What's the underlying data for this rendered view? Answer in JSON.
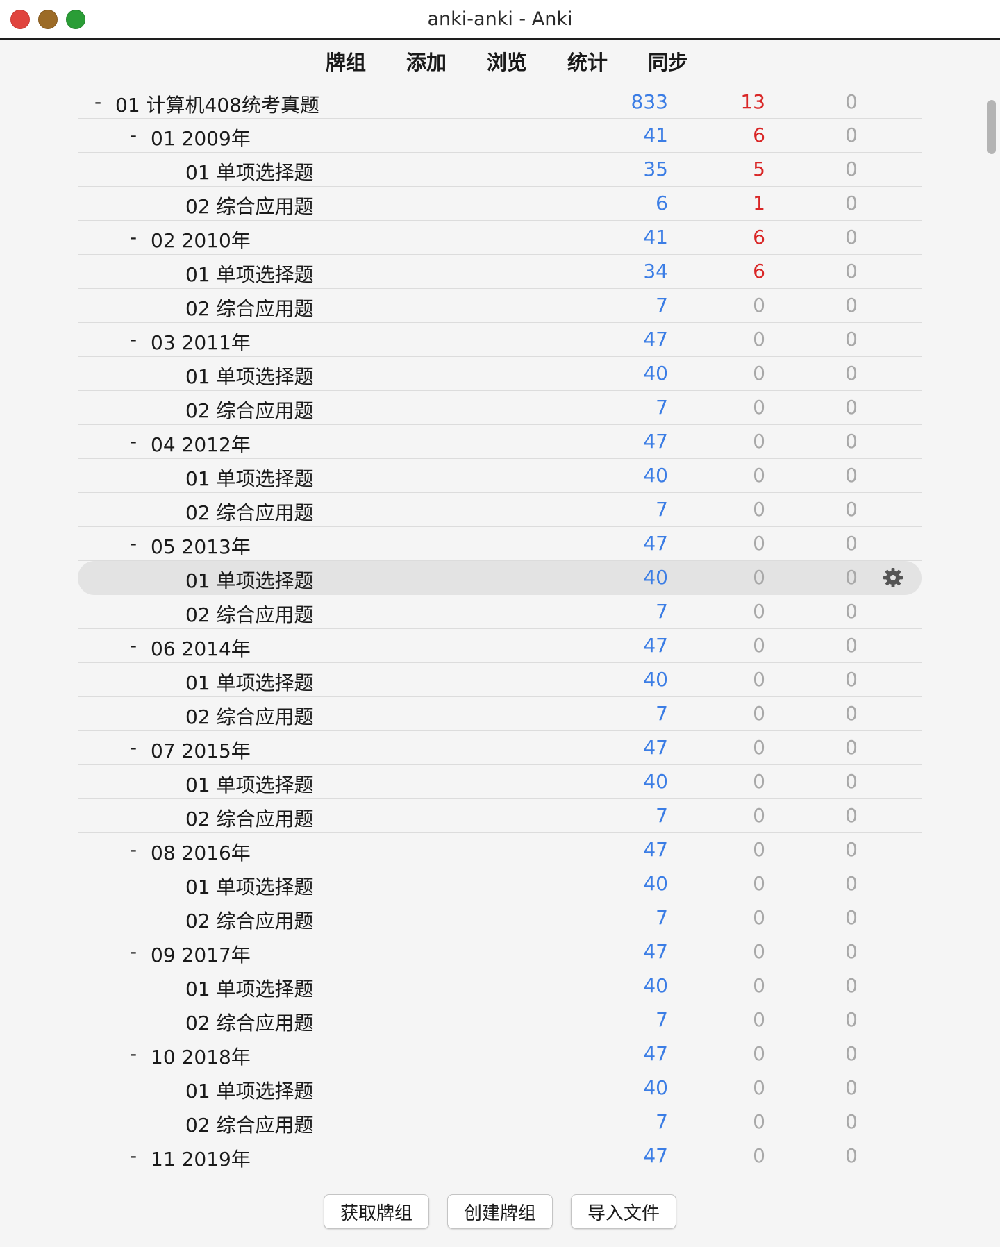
{
  "window": {
    "title": "anki-anki - Anki"
  },
  "toolbar": {
    "items": [
      "牌组",
      "添加",
      "浏览",
      "统计",
      "同步"
    ]
  },
  "colors": {
    "new_count": "#3b7de5",
    "learn_count": "#d92626",
    "zero_count": "#a8a8a8"
  },
  "decks": [
    {
      "level": 0,
      "expander": "-",
      "name": "01 计算机408统考真题",
      "new": "833",
      "learn": "13",
      "due": "0"
    },
    {
      "level": 1,
      "expander": "-",
      "name": "01 2009年",
      "new": "41",
      "learn": "6",
      "due": "0"
    },
    {
      "level": 2,
      "expander": "",
      "name": "01 单项选择题",
      "new": "35",
      "learn": "5",
      "due": "0"
    },
    {
      "level": 2,
      "expander": "",
      "name": "02 综合应用题",
      "new": "6",
      "learn": "1",
      "due": "0"
    },
    {
      "level": 1,
      "expander": "-",
      "name": "02 2010年",
      "new": "41",
      "learn": "6",
      "due": "0"
    },
    {
      "level": 2,
      "expander": "",
      "name": "01 单项选择题",
      "new": "34",
      "learn": "6",
      "due": "0"
    },
    {
      "level": 2,
      "expander": "",
      "name": "02 综合应用题",
      "new": "7",
      "learn": "0",
      "due": "0"
    },
    {
      "level": 1,
      "expander": "-",
      "name": "03 2011年",
      "new": "47",
      "learn": "0",
      "due": "0"
    },
    {
      "level": 2,
      "expander": "",
      "name": "01 单项选择题",
      "new": "40",
      "learn": "0",
      "due": "0"
    },
    {
      "level": 2,
      "expander": "",
      "name": "02 综合应用题",
      "new": "7",
      "learn": "0",
      "due": "0"
    },
    {
      "level": 1,
      "expander": "-",
      "name": "04 2012年",
      "new": "47",
      "learn": "0",
      "due": "0"
    },
    {
      "level": 2,
      "expander": "",
      "name": "01 单项选择题",
      "new": "40",
      "learn": "0",
      "due": "0"
    },
    {
      "level": 2,
      "expander": "",
      "name": "02 综合应用题",
      "new": "7",
      "learn": "0",
      "due": "0"
    },
    {
      "level": 1,
      "expander": "-",
      "name": "05 2013年",
      "new": "47",
      "learn": "0",
      "due": "0"
    },
    {
      "level": 2,
      "expander": "",
      "name": "01 单项选择题",
      "new": "40",
      "learn": "0",
      "due": "0",
      "selected": true
    },
    {
      "level": 2,
      "expander": "",
      "name": "02 综合应用题",
      "new": "7",
      "learn": "0",
      "due": "0"
    },
    {
      "level": 1,
      "expander": "-",
      "name": "06 2014年",
      "new": "47",
      "learn": "0",
      "due": "0"
    },
    {
      "level": 2,
      "expander": "",
      "name": "01 单项选择题",
      "new": "40",
      "learn": "0",
      "due": "0"
    },
    {
      "level": 2,
      "expander": "",
      "name": "02 综合应用题",
      "new": "7",
      "learn": "0",
      "due": "0"
    },
    {
      "level": 1,
      "expander": "-",
      "name": "07 2015年",
      "new": "47",
      "learn": "0",
      "due": "0"
    },
    {
      "level": 2,
      "expander": "",
      "name": "01 单项选择题",
      "new": "40",
      "learn": "0",
      "due": "0"
    },
    {
      "level": 2,
      "expander": "",
      "name": "02 综合应用题",
      "new": "7",
      "learn": "0",
      "due": "0"
    },
    {
      "level": 1,
      "expander": "-",
      "name": "08 2016年",
      "new": "47",
      "learn": "0",
      "due": "0"
    },
    {
      "level": 2,
      "expander": "",
      "name": "01 单项选择题",
      "new": "40",
      "learn": "0",
      "due": "0"
    },
    {
      "level": 2,
      "expander": "",
      "name": "02 综合应用题",
      "new": "7",
      "learn": "0",
      "due": "0"
    },
    {
      "level": 1,
      "expander": "-",
      "name": "09 2017年",
      "new": "47",
      "learn": "0",
      "due": "0"
    },
    {
      "level": 2,
      "expander": "",
      "name": "01 单项选择题",
      "new": "40",
      "learn": "0",
      "due": "0"
    },
    {
      "level": 2,
      "expander": "",
      "name": "02 综合应用题",
      "new": "7",
      "learn": "0",
      "due": "0"
    },
    {
      "level": 1,
      "expander": "-",
      "name": "10 2018年",
      "new": "47",
      "learn": "0",
      "due": "0"
    },
    {
      "level": 2,
      "expander": "",
      "name": "01 单项选择题",
      "new": "40",
      "learn": "0",
      "due": "0"
    },
    {
      "level": 2,
      "expander": "",
      "name": "02 综合应用题",
      "new": "7",
      "learn": "0",
      "due": "0"
    },
    {
      "level": 1,
      "expander": "-",
      "name": "11 2019年",
      "new": "47",
      "learn": "0",
      "due": "0"
    }
  ],
  "bottom_buttons": {
    "get_shared": "获取牌组",
    "create_deck": "创建牌组",
    "import_file": "导入文件"
  },
  "icons": {
    "options": "gear-icon"
  }
}
